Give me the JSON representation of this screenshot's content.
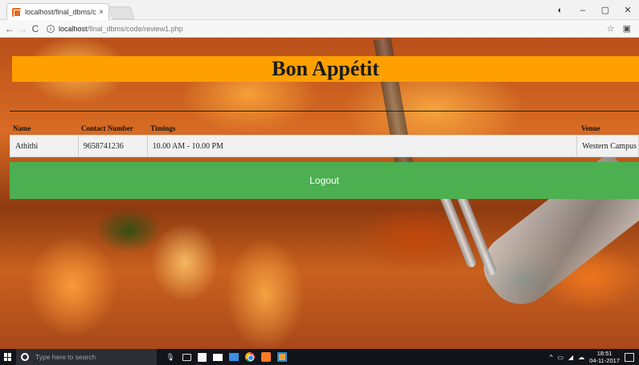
{
  "browser": {
    "tab_title": "localhost/final_dbms/co",
    "tab_close": "×",
    "url_host": "localhost",
    "url_path": "/final_dbms/code/review1.php",
    "nav": {
      "back": "←",
      "forward": "→",
      "reload": "C"
    },
    "window": {
      "minimize": "–",
      "maximize": "▢",
      "close": "✕"
    },
    "profile_icon": "◐",
    "star_icon": "☆",
    "ext_icon": "▣"
  },
  "page": {
    "title": "Bon Appétit",
    "table": {
      "headers": [
        "Name",
        "Contact Number",
        "Timings",
        "Venue"
      ],
      "rows": [
        [
          "Athithi",
          "9658741236",
          "10.00 AM - 10.00 PM",
          "Western Campus"
        ]
      ]
    },
    "logout_label": "Logout",
    "colors": {
      "banner": "#ffa000",
      "logout": "#4caf50"
    }
  },
  "taskbar": {
    "search_placeholder": "Type here to search",
    "time": "18:51",
    "date": "04-11-2017",
    "tray_up": "^",
    "mic": "🎙"
  }
}
